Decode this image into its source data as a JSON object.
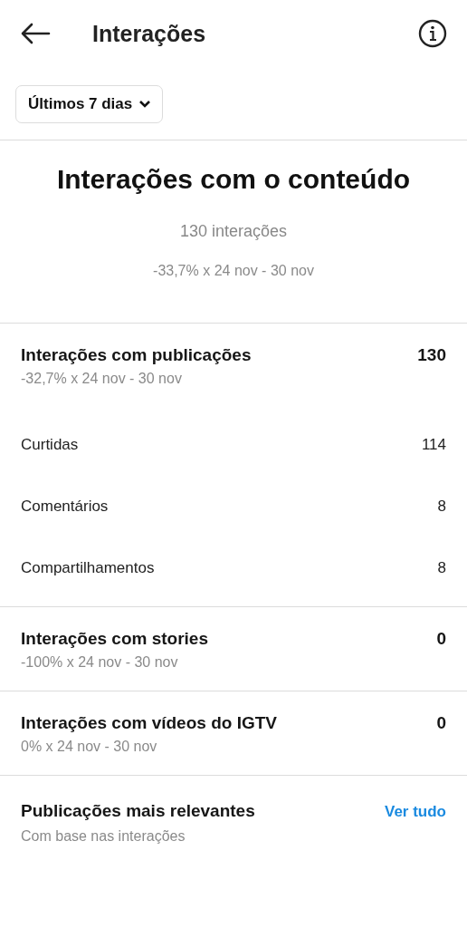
{
  "header": {
    "title": "Interações"
  },
  "filter": {
    "label": "Últimos 7 dias"
  },
  "summary": {
    "title": "Interações com o conteúdo",
    "count": "130 interações",
    "comparison": "-33,7% x 24 nov - 30 nov"
  },
  "sections": [
    {
      "title": "Interações com publicações",
      "value": "130",
      "comparison": "-32,7% x 24 nov - 30 nov",
      "rows": [
        {
          "label": "Curtidas",
          "value": "114"
        },
        {
          "label": "Comentários",
          "value": "8"
        },
        {
          "label": "Compartilhamentos",
          "value": "8"
        }
      ]
    },
    {
      "title": "Interações com stories",
      "value": "0",
      "comparison": "-100% x 24 nov - 30 nov"
    },
    {
      "title": "Interações com vídeos do IGTV",
      "value": "0",
      "comparison": "0% x 24 nov - 30 nov"
    }
  ],
  "top_posts": {
    "title": "Publicações mais relevantes",
    "subtitle": "Com base nas interações",
    "link": "Ver tudo"
  }
}
